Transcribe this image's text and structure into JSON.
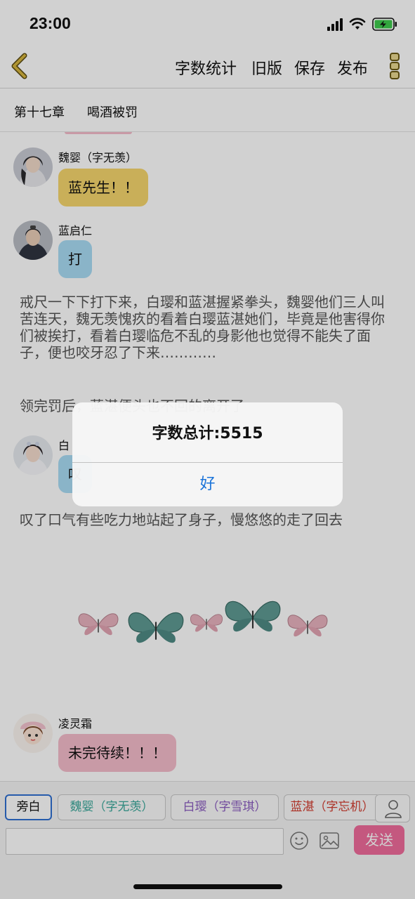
{
  "status_bar": {
    "time": "23:00"
  },
  "nav": {
    "actions": [
      "字数统计",
      "旧版",
      "保存",
      "发布"
    ]
  },
  "chapter": {
    "number": "第十七章",
    "title": "喝酒被罚"
  },
  "messages": [
    {
      "name": "魏婴（字无羡）",
      "text": "蓝先生！！",
      "bubble_color": "#f6d66d"
    },
    {
      "name": "蓝启仁",
      "text": "打",
      "bubble_color": "#a9dcf5"
    },
    {
      "name": "白",
      "text": "叹",
      "bubble_color": "#a9dcf5"
    },
    {
      "name": "凌灵霜",
      "text": "未完待续！！！",
      "bubble_color": "#f4bccb"
    }
  ],
  "narration": {
    "p1": "戒尺一下下打下来，白璎和蓝湛握紧拳头，魏婴他们三人叫苦连天，魏无羡愧疚的看着白璎蓝湛她们，毕竟是他害得你们被挨打，看着白璎临危不乱的身影他也觉得不能失了面子，便也咬牙忍了下来…………",
    "p2": "领完罚后，蓝湛便头也不回的离开了",
    "p3": "叹了口气有些吃力地站起了身子，慢悠悠的走了回去"
  },
  "role_bar": {
    "chips": [
      {
        "label": "旁白",
        "color": "#111111"
      },
      {
        "label": "魏婴（字无羡）",
        "color": "#3aa89a"
      },
      {
        "label": "白璎（字雪琪）",
        "color": "#8a5cc0"
      },
      {
        "label": "蓝湛（字忘机）",
        "color": "#d23c2f"
      }
    ]
  },
  "composer": {
    "placeholder": "",
    "send_label": "发送",
    "send_color": "#f06c9b"
  },
  "alert": {
    "title": "字数总计:5515",
    "button": "好",
    "button_color": "#1a73d9"
  },
  "colors": {
    "accent_gold": "#d6b53e"
  }
}
